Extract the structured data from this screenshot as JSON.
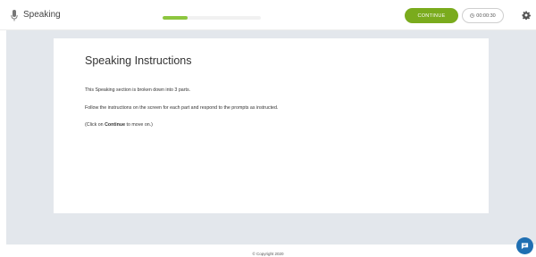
{
  "header": {
    "title": "Speaking",
    "progress": 0.25,
    "continue_label": "CONTINUE",
    "timer": "00:00:30"
  },
  "card": {
    "heading": "Speaking Instructions",
    "line1": "This Speaking section is broken down into 3 parts.",
    "line2": "Follow the instructions on the screen for each part and respond to the prompts as instructed.",
    "line3_prefix": "(Click on ",
    "line3_bold": "Continue",
    "line3_suffix": " to move on.)"
  },
  "footer": {
    "copyright": "© Copyright 2020"
  },
  "colors": {
    "accent": "#7aab1d",
    "progress": "#8dc63f",
    "chat": "#1f6fb2",
    "background": "#e3e7ec"
  },
  "icons": {
    "title_icon": "microphone-icon",
    "timer_icon": "clock-icon",
    "settings_icon": "gear-icon",
    "chat_icon": "chat-icon"
  }
}
